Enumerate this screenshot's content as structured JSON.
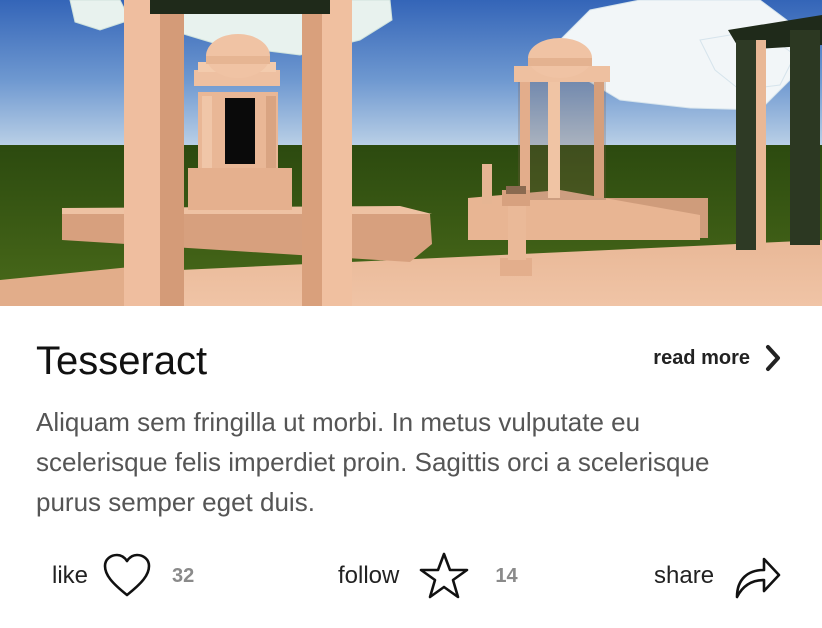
{
  "card": {
    "image_alt": "Low-poly 3D scene of classical domed pavilions and columns on a platform under a blue sky",
    "title": "Tesseract",
    "read_more_label": "read more",
    "description": "Aliquam sem fringilla ut morbi. In metus vulputate eu scelerisque felis imperdiet proin. Sagittis orci a scelerisque purus semper eget duis."
  },
  "actions": {
    "like": {
      "label": "like",
      "count": "32",
      "icon": "heart-outline-icon"
    },
    "follow": {
      "label": "follow",
      "count": "14",
      "icon": "star-outline-icon"
    },
    "share": {
      "label": "share",
      "icon": "share-arrow-icon"
    }
  },
  "colors": {
    "title": "#111111",
    "body_text": "#555555",
    "count_text": "#8a8a8a",
    "sky_top": "#3b6fc0",
    "grass": "#3d5c14",
    "stone": "#e6b595"
  }
}
